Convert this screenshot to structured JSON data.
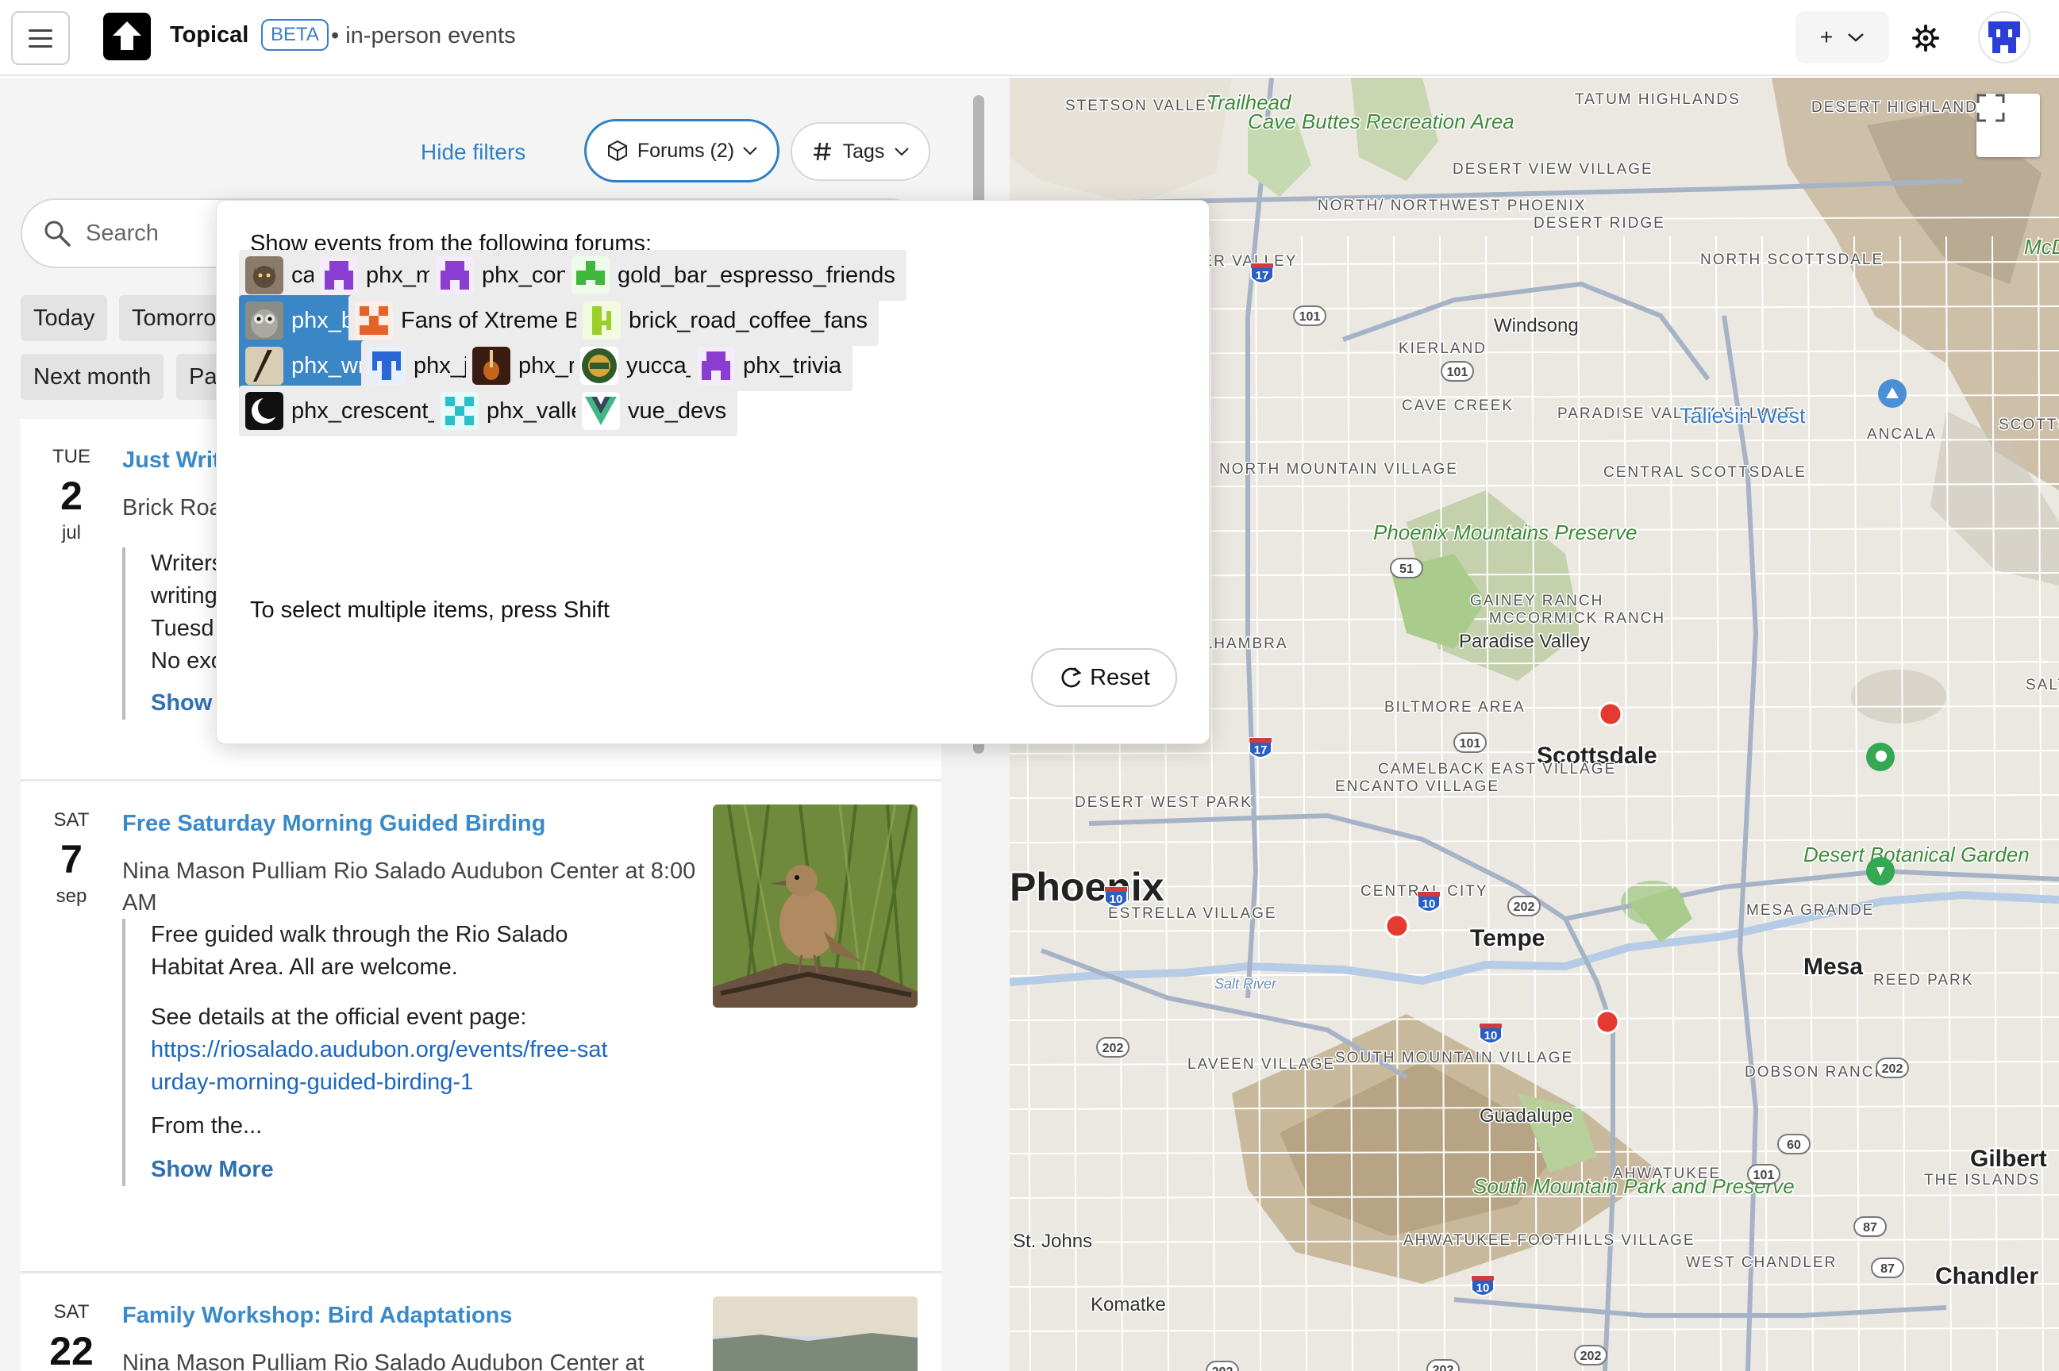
{
  "header": {
    "app_title": "Topical",
    "beta_label": "BETA",
    "subtitle": "• in-person events",
    "add_label": "+"
  },
  "filters": {
    "hide_filters": "Hide filters",
    "forums_label": "Forums (2)",
    "tags_label": "Tags",
    "search_placeholder": "Search",
    "quick_chips": [
      "Today",
      "Tomorrow",
      "Next month",
      "Past"
    ]
  },
  "popover": {
    "heading": "Show events from the following forums:",
    "hint": "To select multiple items, press Shift",
    "reset_label": "Reset",
    "forums": [
      {
        "name": "cats",
        "selected": false,
        "icon": "cat-photo-icon"
      },
      {
        "name": "phx_music",
        "selected": false,
        "icon": "purple-pixel-icon"
      },
      {
        "name": "phx_concerts",
        "selected": false,
        "icon": "purple-pixel-icon"
      },
      {
        "name": "gold_bar_espresso_friends",
        "selected": false,
        "icon": "green-pixel-icon"
      },
      {
        "name": "phx_birds",
        "selected": true,
        "icon": "owl-photo-icon"
      },
      {
        "name": "Fans of Xtreme Bean Coffee",
        "selected": false,
        "icon": "orange-pixel-icon"
      },
      {
        "name": "brick_road_coffee_fans",
        "selected": false,
        "icon": "lime-pixel-icon"
      },
      {
        "name": "phx_writers",
        "selected": true,
        "icon": "quill-photo-icon"
      },
      {
        "name": "phx_jazz",
        "selected": false,
        "icon": "blue-pixel-icon"
      },
      {
        "name": "phx_rock",
        "selected": false,
        "icon": "guitar-photo-icon"
      },
      {
        "name": "yucca_phx",
        "selected": false,
        "icon": "yucca-badge-icon"
      },
      {
        "name": "phx_trivia",
        "selected": false,
        "icon": "purple-pixel-icon"
      },
      {
        "name": "phx_crescent_ballroom",
        "selected": false,
        "icon": "crescent-logo-icon"
      },
      {
        "name": "phx_valley_bar",
        "selected": false,
        "icon": "cyan-pixel-icon"
      },
      {
        "name": "vue_devs",
        "selected": false,
        "icon": "vue-logo-icon"
      }
    ]
  },
  "events": [
    {
      "dow": "TUE",
      "day": "2",
      "month": "jul",
      "title": "Just Write",
      "venue": "Brick Road",
      "body": [
        "Writers",
        "writing",
        "Tuesd",
        "No exc"
      ],
      "show_more": "Show More"
    },
    {
      "dow": "SAT",
      "day": "7",
      "month": "sep",
      "title": "Free Saturday Morning Guided Birding",
      "venue": "Nina Mason Pulliam Rio Salado Audubon Center at 8:00 AM",
      "body_intro": "Free guided walk through the Rio Salado Habitat Area. All are welcome.",
      "body_details": "See details at the official event page:",
      "link": "https://riosalado.audubon.org/events/free-saturday-morning-guided-birding-1",
      "body_more": "From the...",
      "show_more": "Show More"
    },
    {
      "dow": "SAT",
      "day": "22",
      "month": "",
      "title": "Family Workshop: Bird Adaptations",
      "venue": "Nina Mason Pulliam Rio Salado Audubon Center at"
    }
  ],
  "map": {
    "labels": [
      {
        "text": "STETSON VALLEY",
        "kind": "area"
      },
      {
        "text": "Trailhead",
        "kind": "park"
      },
      {
        "text": "Cave Buttes Recreation Area",
        "kind": "park"
      },
      {
        "text": "TATUM HIGHLANDS",
        "kind": "area"
      },
      {
        "text": "DESERT HIGHLANDS",
        "kind": "area"
      },
      {
        "text": "DESERT VIEW VILLAGE",
        "kind": "area"
      },
      {
        "text": "NORTH/ NORTHWEST PHOENIX",
        "kind": "area"
      },
      {
        "text": "DESERT RIDGE",
        "kind": "area"
      },
      {
        "text": "NORTH SCOTTSDALE",
        "kind": "area"
      },
      {
        "text": "McDowell Mountain Regional Hunting",
        "kind": "park"
      },
      {
        "text": "DEER VALLEY",
        "kind": "area"
      },
      {
        "text": "Windsong",
        "kind": "place"
      },
      {
        "text": "KIERLAND",
        "kind": "area"
      },
      {
        "text": "CAVE CREEK",
        "kind": "area"
      },
      {
        "text": "PARADISE VALLEY VILLAGE",
        "kind": "area"
      },
      {
        "text": "Taliesin West",
        "kind": "poi"
      },
      {
        "text": "SCOTTSDALE MOUNTAIN",
        "kind": "area"
      },
      {
        "text": "ANCALA",
        "kind": "area"
      },
      {
        "text": "NORTH MOUNTAIN VILLAGE",
        "kind": "area"
      },
      {
        "text": "CENTRAL SCOTTSDALE",
        "kind": "area"
      },
      {
        "text": "Phoenix Mountains Preserve",
        "kind": "park"
      },
      {
        "text": "GAINEY RANCH",
        "kind": "area"
      },
      {
        "text": "MCCORMICK RANCH",
        "kind": "area"
      },
      {
        "text": "ALHAMBRA",
        "kind": "area"
      },
      {
        "text": "Paradise Valley",
        "kind": "place"
      },
      {
        "text": "SALT RIVER",
        "kind": "area"
      },
      {
        "text": "BILTMORE AREA",
        "kind": "area"
      },
      {
        "text": "Scottsdale",
        "kind": "city"
      },
      {
        "text": "CAMELBACK EAST VILLAGE",
        "kind": "area"
      },
      {
        "text": "ENCANTO VILLAGE",
        "kind": "area"
      },
      {
        "text": "DESERT WEST PARK",
        "kind": "area"
      },
      {
        "text": "Desert Botanical Garden",
        "kind": "park"
      },
      {
        "text": "Phoenix",
        "kind": "bigcity"
      },
      {
        "text": "CENTRAL CITY",
        "kind": "area"
      },
      {
        "text": "MESA GRANDE",
        "kind": "area"
      },
      {
        "text": "ESTRELLA VILLAGE",
        "kind": "area"
      },
      {
        "text": "Tempe",
        "kind": "city"
      },
      {
        "text": "Mesa",
        "kind": "city"
      },
      {
        "text": "Salt River",
        "kind": "water"
      },
      {
        "text": "REED PARK",
        "kind": "area"
      },
      {
        "text": "LAVEEN VILLAGE",
        "kind": "area"
      },
      {
        "text": "SOUTH MOUNTAIN VILLAGE",
        "kind": "area"
      },
      {
        "text": "DOBSON RANCH",
        "kind": "area"
      },
      {
        "text": "Guadalupe",
        "kind": "place"
      },
      {
        "text": "Gilbert",
        "kind": "city"
      },
      {
        "text": "South Mountain Park and Preserve",
        "kind": "park"
      },
      {
        "text": "AHWATUKEE",
        "kind": "area"
      },
      {
        "text": "THE ISLANDS",
        "kind": "area"
      },
      {
        "text": "St. Johns",
        "kind": "place"
      },
      {
        "text": "AHWATUKEE FOOTHILLS VILLAGE",
        "kind": "area"
      },
      {
        "text": "WEST CHANDLER",
        "kind": "area"
      },
      {
        "text": "Chandler",
        "kind": "city"
      },
      {
        "text": "Komatke",
        "kind": "place"
      }
    ],
    "shields": [
      "17",
      "101",
      "101",
      "51",
      "17",
      "101",
      "10",
      "10",
      "202",
      "202",
      "10",
      "202",
      "87",
      "60",
      "101",
      "10",
      "87",
      "202",
      "202",
      "202"
    ],
    "markers": 3
  },
  "colors": {
    "accent": "#2f80c4",
    "selected_chip": "#3b86c6",
    "link": "#1a66c1",
    "marker": "#e53a2f"
  }
}
